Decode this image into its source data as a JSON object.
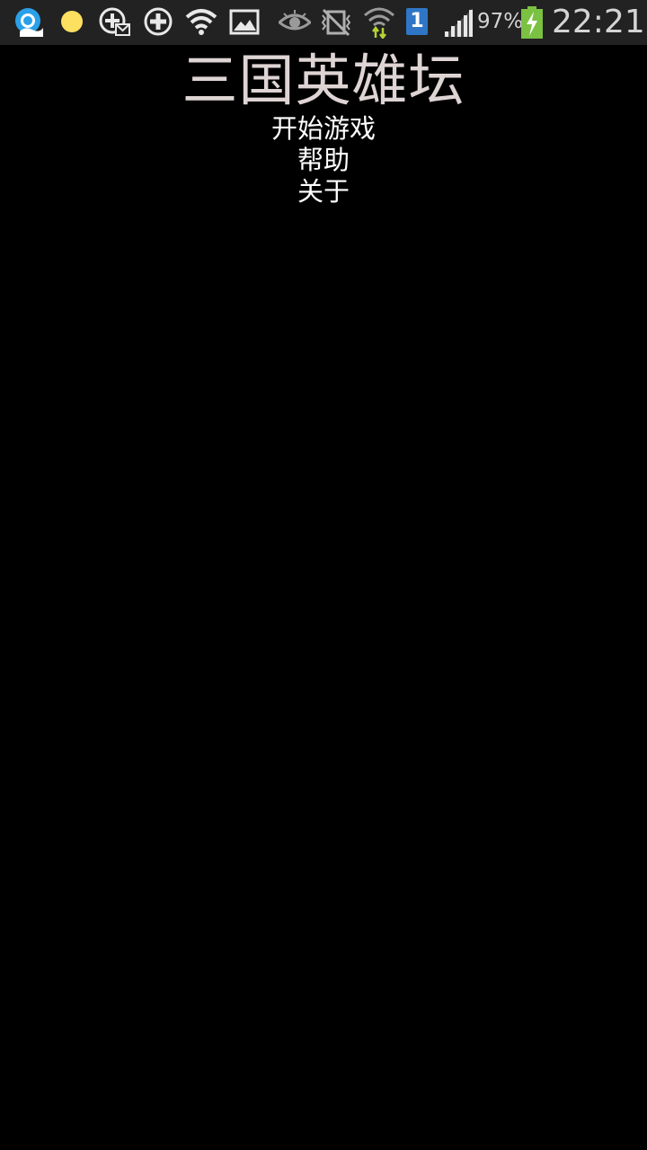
{
  "status_bar": {
    "battery_percent": "97%",
    "time": "22:21",
    "sim_slot": "1",
    "icons": [
      "browser-icon",
      "notification-dot-icon",
      "mail-plus-icon",
      "add-circle-icon",
      "wifi-help-icon",
      "gallery-icon",
      "eye-icon",
      "mute-icon",
      "wifi-data-icon",
      "sim-icon",
      "signal-icon",
      "battery-charging-icon"
    ],
    "colors": {
      "bar_background": "#222222",
      "icon_color": "#e8e8e8",
      "battery_green": "#7bc142",
      "data_arrow": "#b5d334",
      "sim_blue": "#2f76c6",
      "dot_yellow": "#fde060"
    }
  },
  "app": {
    "title": "三国英雄坛",
    "title_color": "#ded4d4",
    "background": "#000000",
    "menu": [
      {
        "label": "开始游戏"
      },
      {
        "label": "帮助"
      },
      {
        "label": "关于"
      }
    ]
  }
}
